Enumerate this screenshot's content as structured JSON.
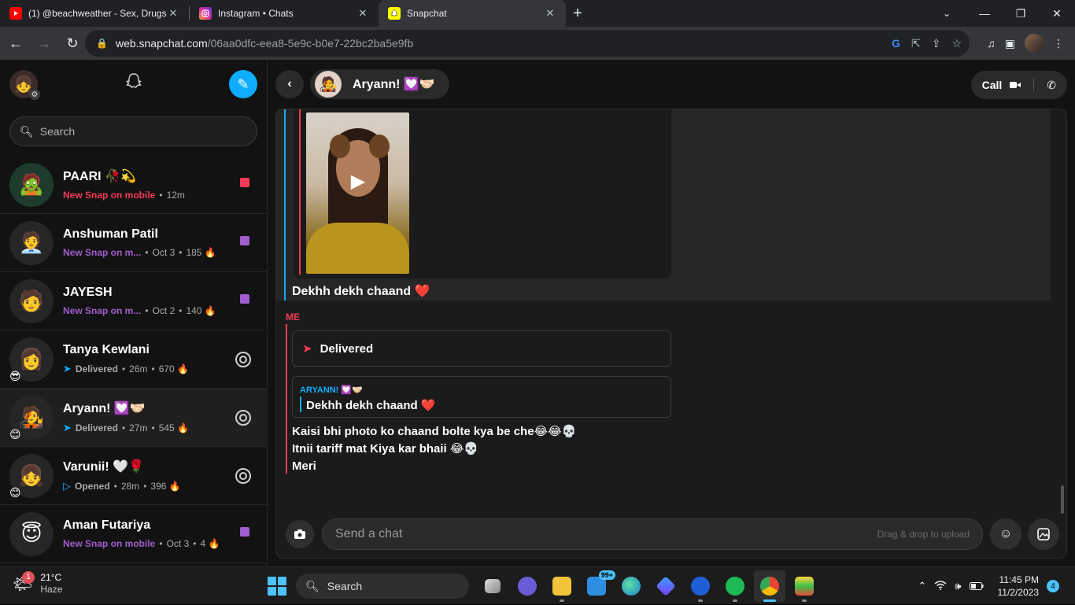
{
  "browser": {
    "tabs": [
      {
        "title": "(1) @beachweather - Sex, Drugs,",
        "icon": "youtube-icon",
        "color": "#ff0000"
      },
      {
        "title": "Instagram • Chats",
        "icon": "instagram-icon",
        "color": "#d6249f"
      },
      {
        "title": "Snapchat",
        "icon": "snapchat-icon",
        "color": "#fffc00"
      }
    ],
    "url_host": "web.snapchat.com",
    "url_path": "/06aa0dfc-eea8-5e9c-b0e7-22bc2ba5e9fb"
  },
  "sidebar": {
    "search_placeholder": "Search",
    "chats": [
      {
        "name": "PAARI 🥀💫",
        "status": "New Snap on mobile",
        "status_type": "red",
        "time": "12m",
        "streak": "",
        "indicator": "red-square"
      },
      {
        "name": "Anshuman Patil",
        "status": "New Snap on m...",
        "status_type": "purple",
        "time": "Oct 3",
        "streak": "185 🔥",
        "indicator": "purple-square"
      },
      {
        "name": "JAYESH",
        "status": "New Snap on m...",
        "status_type": "purple",
        "time": "Oct 2",
        "streak": "140 🔥",
        "indicator": "purple-square"
      },
      {
        "name": "Tanya Kewlani",
        "status": "Delivered",
        "status_type": "blue",
        "time": "26m",
        "streak": "670 🔥",
        "indicator": "camera",
        "emoji": "😎"
      },
      {
        "name": "Aryann! 💟🤝🏻",
        "status": "Delivered",
        "status_type": "blue",
        "time": "27m",
        "streak": "545 🔥",
        "indicator": "camera",
        "emoji": "😊"
      },
      {
        "name": "Varunii! 🤍🌹",
        "status": "Opened",
        "status_type": "opened",
        "time": "28m",
        "streak": "396 🔥",
        "indicator": "camera",
        "emoji": "😊"
      },
      {
        "name": "Aman Futariya",
        "status": "New Snap on mobile",
        "status_type": "purple",
        "time": "Oct 3",
        "streak": "4 🔥",
        "indicator": "purple-square"
      }
    ]
  },
  "conversation": {
    "friend_name": "Aryann! 💟🤝🏻",
    "call_label": "Call",
    "quoted_caption": "Dekhh dekh chaand ❤️",
    "me_label": "ME",
    "delivered_label": "Delivered",
    "reply_who": "ARYANN! 💟🤝🏻",
    "reply_text": "Dekhh dekh chaand ❤️",
    "messages": [
      "Kaisi bhi photo ko chaand bolte kya be che😂😂💀",
      "Itnii tariff mat Kiya kar bhaii 😂💀",
      "Meri"
    ],
    "input_placeholder": "Send a chat",
    "input_hint": "Drag & drop to upload"
  },
  "taskbar": {
    "weather_temp": "21°C",
    "weather_desc": "Haze",
    "weather_badge": "1",
    "search_label": "Search",
    "mail_badge": "99+",
    "time": "11:45 PM",
    "date": "11/2/2023",
    "notifications": "4"
  },
  "colors": {
    "snap_red": "#f23c57",
    "snap_purple": "#a05dcd",
    "snap_blue": "#0fadff"
  }
}
